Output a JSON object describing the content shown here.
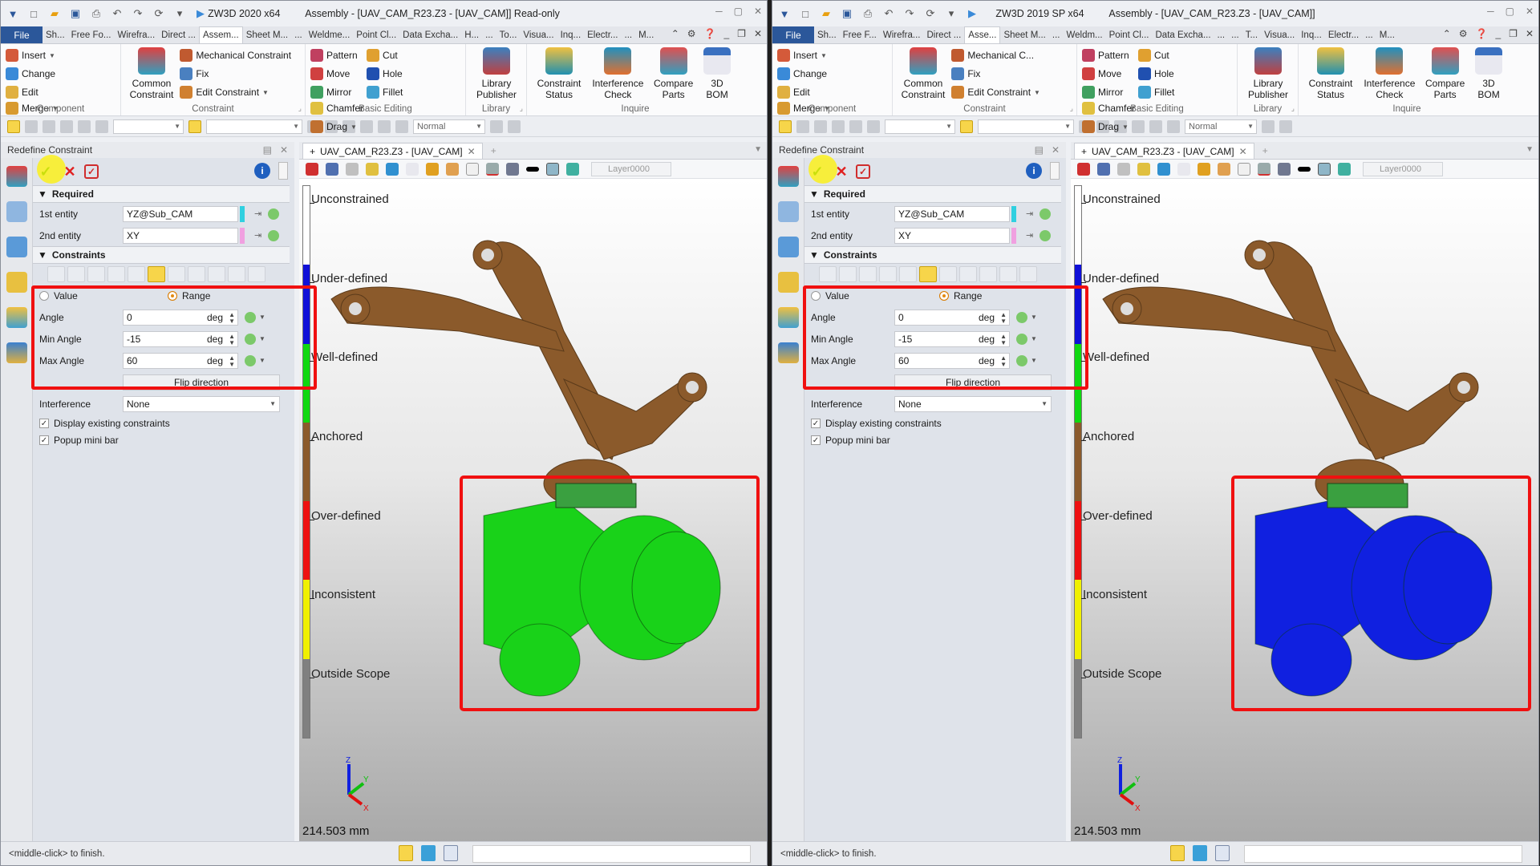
{
  "windows": [
    {
      "id": "left",
      "title_product": "ZW3D 2020  x64",
      "title_doc": "Assembly - [UAV_CAM_R23.Z3 - [UAV_CAM]] Read-only",
      "menu_tabs": [
        "File",
        "Sh...",
        "Free Fo...",
        "Wirefra...",
        "Direct ...",
        "Assem...",
        "Sheet M...",
        "...",
        "Weldme...",
        "Point Cl...",
        "Data Excha...",
        "H...",
        "...",
        "To...",
        "Visua...",
        "Inq...",
        "Electr...",
        "...",
        "M..."
      ],
      "active_tab": "Assem...",
      "ribbon": {
        "component": {
          "label": "Component",
          "items": [
            "Insert",
            "Merge",
            "Change",
            "Edit"
          ]
        },
        "common_constraint": "Common Constraint",
        "constraint": {
          "label": "Constraint",
          "items": [
            "Mechanical Constraint",
            "Fix",
            "Edit Constraint"
          ]
        },
        "basic_editing": {
          "label": "Basic Editing",
          "items": [
            "Pattern",
            "Cut",
            "Chamfer",
            "Move",
            "Hole",
            "Drag",
            "Mirror",
            "Fillet"
          ]
        },
        "library": {
          "label": "Library",
          "items": [
            "Library Publisher"
          ]
        },
        "inquire": {
          "label": "Inquire",
          "items": [
            "Constraint Status",
            "Interference Check",
            "Compare Parts",
            "3D BOM"
          ]
        }
      },
      "toolbar": {
        "render_mode": "Normal"
      },
      "panel": {
        "title": "Redefine Constraint",
        "required_label": "Required",
        "first_entity_label": "1st entity",
        "first_entity_value": "YZ@Sub_CAM",
        "second_entity_label": "2nd entity",
        "second_entity_value": "XY",
        "constraints_label": "Constraints",
        "mode_value_label": "Value",
        "mode_range_label": "Range",
        "mode_selected": "Range",
        "angle_label": "Angle",
        "angle_value": "0",
        "min_angle_label": "Min Angle",
        "min_angle_value": "-15",
        "max_angle_label": "Max Angle",
        "max_angle_value": "60",
        "unit": "deg",
        "flip_label": "Flip direction",
        "interference_label": "Interference",
        "interference_value": "None",
        "display_existing_label": "Display existing constraints",
        "display_existing_checked": true,
        "popup_minibar_label": "Popup mini bar",
        "popup_minibar_checked": true
      },
      "doc_tab": "UAV_CAM_R23.Z3 - [UAV_CAM]",
      "layer": "Layer0000",
      "legend": [
        "Unconstrained",
        "Under-defined",
        "Well-defined",
        "Anchored",
        "Over-defined",
        "Inconsistent",
        "Outside Scope"
      ],
      "scale_text": "214.503 mm",
      "status_text": "<middle-click> to finish.",
      "camera_color": "#19d219"
    },
    {
      "id": "right",
      "title_product": "ZW3D 2019 SP x64",
      "title_doc": "Assembly - [UAV_CAM_R23.Z3 - [UAV_CAM]]",
      "menu_tabs": [
        "File",
        "Sh...",
        "Free F...",
        "Wirefra...",
        "Direct ...",
        "Asse...",
        "Sheet M...",
        "...",
        "Weldm...",
        "Point Cl...",
        "Data Excha...",
        "...",
        "...",
        "T...",
        "Visua...",
        "Inq...",
        "Electr...",
        "...",
        "M..."
      ],
      "active_tab": "Asse...",
      "ribbon": {
        "component": {
          "label": "Component",
          "items": [
            "Insert",
            "Change",
            "Merge",
            "Edit"
          ]
        },
        "common_constraint": "Common Constraint",
        "constraint": {
          "label": "Constraint",
          "items": [
            "Mechanical C...",
            "Fix",
            "Edit Constraint"
          ]
        },
        "basic_editing": {
          "label": "Basic Editing",
          "items": [
            "Pattern",
            "Cut",
            "Chamfer",
            "Move",
            "Hole",
            "Drag",
            "Mirror",
            "Fillet"
          ]
        },
        "library": {
          "label": "Library",
          "items": [
            "Library Publisher"
          ]
        },
        "inquire": {
          "label": "Inquire",
          "items": [
            "Constraint Status",
            "Interference Check",
            "Compare Parts",
            "3D BOM"
          ]
        }
      },
      "toolbar": {
        "render_mode": "Normal"
      },
      "panel": {
        "title": "Redefine Constraint",
        "required_label": "Required",
        "first_entity_label": "1st entity",
        "first_entity_value": "YZ@Sub_CAM",
        "second_entity_label": "2nd entity",
        "second_entity_value": "XY",
        "constraints_label": "Constraints",
        "mode_value_label": "Value",
        "mode_range_label": "Range",
        "mode_selected": "Range",
        "angle_label": "Angle",
        "angle_value": "0",
        "min_angle_label": "Min Angle",
        "min_angle_value": "-15",
        "max_angle_label": "Max Angle",
        "max_angle_value": "60",
        "unit": "deg",
        "flip_label": "Flip direction",
        "interference_label": "Interference",
        "interference_value": "None",
        "display_existing_label": "Display existing constraints",
        "display_existing_checked": true,
        "popup_minibar_label": "Popup mini bar",
        "popup_minibar_checked": true
      },
      "doc_tab": "UAV_CAM_R23.Z3 - [UAV_CAM]",
      "layer": "Layer0000",
      "legend": [
        "Unconstrained",
        "Under-defined",
        "Well-defined",
        "Anchored",
        "Over-defined",
        "Inconsistent",
        "Outside Scope"
      ],
      "scale_text": "214.503 mm",
      "status_text": "<middle-click> to finish.",
      "camera_color": "#1020e0"
    }
  ],
  "legend_colors": [
    "#ffffff",
    "#1010d8",
    "#10d810",
    "#8b5a2b",
    "#ee1010",
    "#f0f000",
    "#808080"
  ],
  "frame_color": "#8b5a2b"
}
